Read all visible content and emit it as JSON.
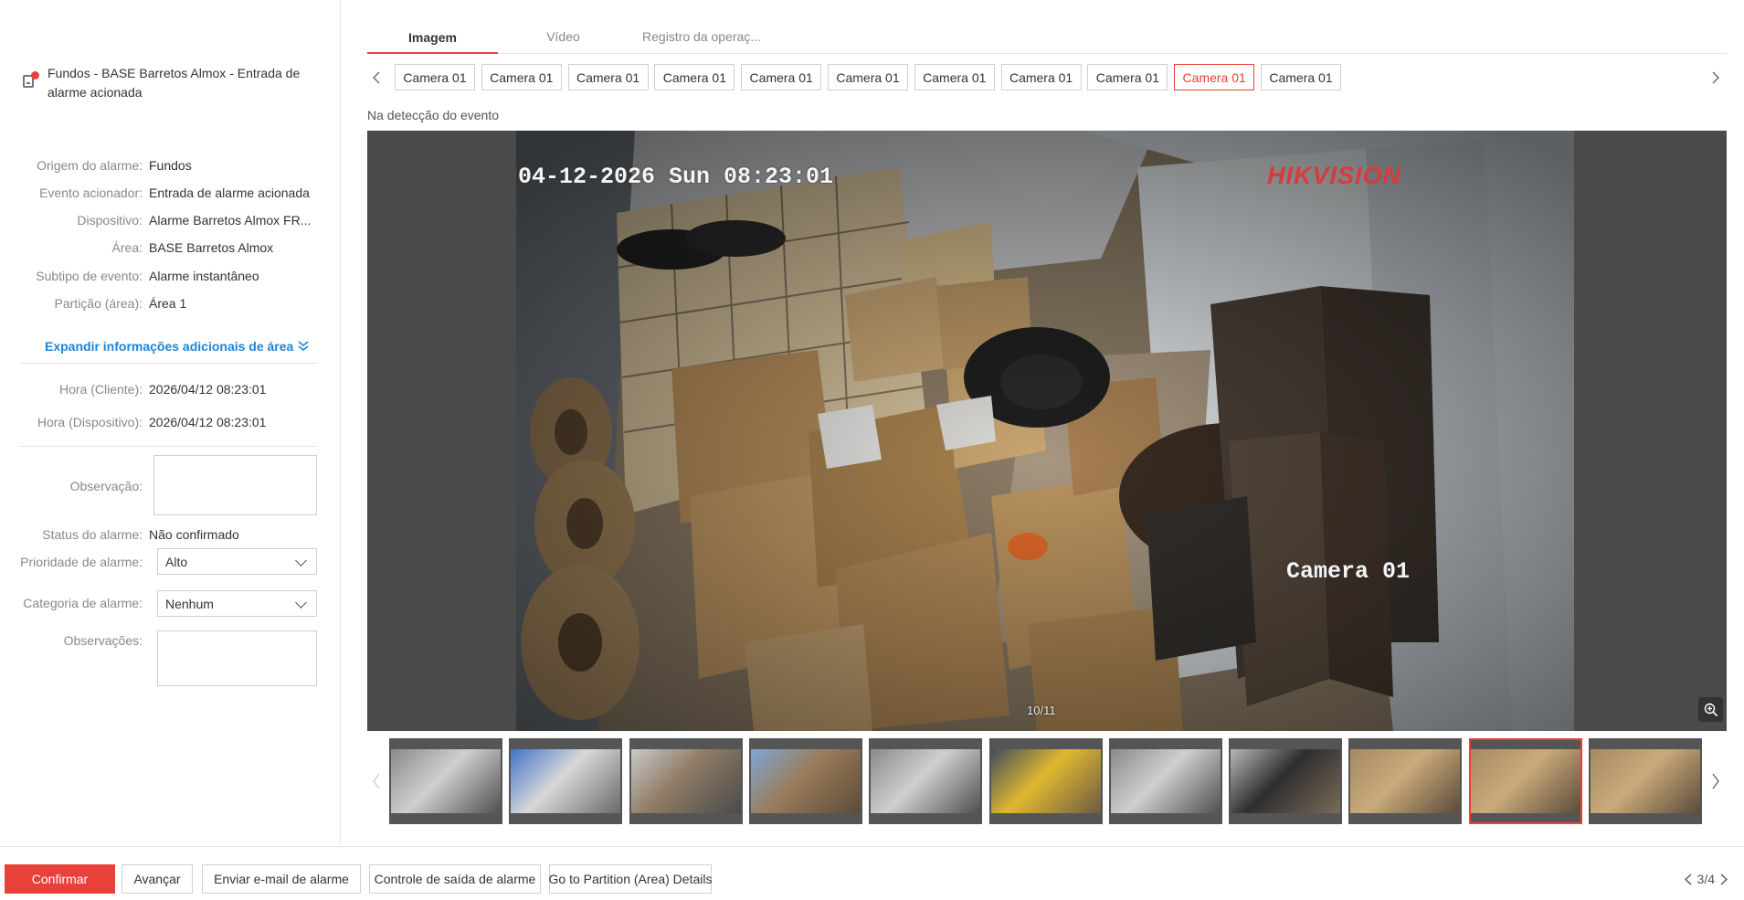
{
  "alarm": {
    "title": "Fundos - BASE Barretos Almox - Entrada de alarme acionada"
  },
  "details": [
    {
      "label": "Origem do alarme:",
      "value": "Fundos"
    },
    {
      "label": "Evento acionador:",
      "value": "Entrada de alarme acionada"
    },
    {
      "label": "Dispositivo:",
      "value": "Alarme Barretos Almox FR..."
    },
    {
      "label": "Área:",
      "value": "BASE Barretos Almox"
    },
    {
      "label": "Subtipo de evento:",
      "value": "Alarme instantâneo"
    },
    {
      "label": "Partição (área):",
      "value": "Área 1"
    }
  ],
  "expand_label": "Expandir informações adicionais de área",
  "times": [
    {
      "label": "Hora (Cliente):",
      "value": "2026/04/12 08:23:01"
    },
    {
      "label": "Hora (Dispositivo):",
      "value": "2026/04/12 08:23:01"
    }
  ],
  "form": {
    "observation_label": "Observação:",
    "observation_value": "",
    "status_label": "Status do alarme:",
    "status_value": "Não confirmado",
    "priority_label": "Prioridade de alarme:",
    "priority_value": "Alto",
    "category_label": "Categoria de alarme:",
    "category_value": "Nenhum",
    "notes_label": "Observações:",
    "notes_value": ""
  },
  "tabs": [
    {
      "label": "Imagem",
      "active": true
    },
    {
      "label": "Vídeo",
      "active": false
    },
    {
      "label": "Registro da operaç...",
      "active": false
    }
  ],
  "cameras": [
    "Camera 01",
    "Camera 01",
    "Camera 01",
    "Camera 01",
    "Camera 01",
    "Camera 01",
    "Camera 01",
    "Camera 01",
    "Camera 01",
    "Camera 01",
    "Camera 01"
  ],
  "selected_camera_index": 9,
  "event_label": "Na detecção do evento",
  "viewer": {
    "osd_time": "04-12-2026 Sun 08:23:01",
    "osd_brand": "HIKVISION",
    "osd_camera": "Camera 01",
    "counter": "10/11"
  },
  "thumbnails": {
    "selected_index": 9,
    "items": [
      "warehouse-gray",
      "parking-lot",
      "warehouse-interior",
      "outdoor-yard",
      "warehouse-gray",
      "yellow-door",
      "warehouse-gray",
      "storage-corner",
      "boxes-room",
      "boxes-room",
      "boxes-room"
    ]
  },
  "buttons": {
    "confirm": "Confirmar",
    "advance": "Avançar",
    "email": "Enviar e-mail de alarme",
    "output": "Controle de saída de alarme",
    "partition": "Go to Partition (Area) Details"
  },
  "pager": "3/4",
  "colors": {
    "accent": "#e8413c",
    "link": "#1e84d6"
  }
}
